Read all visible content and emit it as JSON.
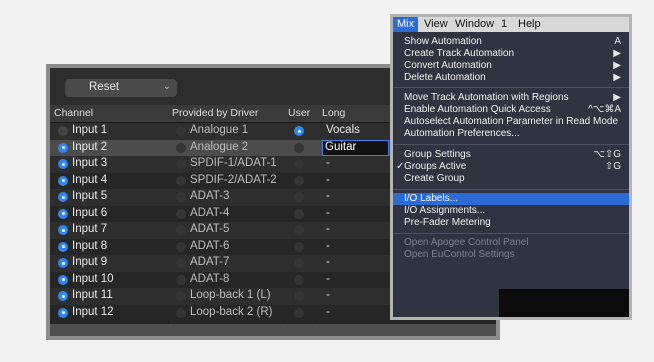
{
  "toolbar": {
    "reset_label": "Reset"
  },
  "columns": {
    "channel": "Channel",
    "driver": "Provided by Driver",
    "user": "User",
    "long": "Long"
  },
  "rows": [
    {
      "channel": "Input 1",
      "driver": "Analogue 1",
      "long": "Vocals"
    },
    {
      "channel": "Input 2",
      "driver": "Analogue 2",
      "long": "Guitar"
    },
    {
      "channel": "Input 3",
      "driver": "SPDIF-1/ADAT-1",
      "long": "-"
    },
    {
      "channel": "Input 4",
      "driver": "SPDIF-2/ADAT-2",
      "long": "-"
    },
    {
      "channel": "Input 5",
      "driver": "ADAT-3",
      "long": "-"
    },
    {
      "channel": "Input 6",
      "driver": "ADAT-4",
      "long": "-"
    },
    {
      "channel": "Input 7",
      "driver": "ADAT-5",
      "long": "-"
    },
    {
      "channel": "Input 8",
      "driver": "ADAT-6",
      "long": "-"
    },
    {
      "channel": "Input 9",
      "driver": "ADAT-7",
      "long": "-"
    },
    {
      "channel": "Input 10",
      "driver": "ADAT-8",
      "long": "-"
    },
    {
      "channel": "Input 11",
      "driver": "Loop-back 1 (L)",
      "long": "-"
    },
    {
      "channel": "Input 12",
      "driver": "Loop-back 2 (R)",
      "long": "-"
    }
  ],
  "menubar": {
    "mix": "Mix",
    "view": "View",
    "window": "Window",
    "one": "1",
    "help": "Help"
  },
  "menu": {
    "show_automation": "Show Automation",
    "show_automation_sc": "A",
    "create_track_automation": "Create Track Automation",
    "convert_automation": "Convert Automation",
    "delete_automation": "Delete Automation",
    "move_track_automation": "Move Track Automation with Regions",
    "enable_quick_access": "Enable Automation Quick Access",
    "enable_quick_access_sc": "^⌥⌘A",
    "autoselect_param": "Autoselect Automation Parameter in Read Mode",
    "automation_prefs": "Automation Preferences...",
    "group_settings": "Group Settings",
    "group_settings_sc": "⌥⇧G",
    "groups_active": "Groups Active",
    "groups_active_sc": "⇧G",
    "create_group": "Create Group",
    "io_labels": "I/O Labels...",
    "io_assignments": "I/O Assignments...",
    "pre_fader_metering": "Pre-Fader Metering",
    "open_apogee": "Open Apogee Control Panel",
    "open_eucontrol": "Open EuControl Settings",
    "arrow": "▶",
    "check": "✓"
  }
}
